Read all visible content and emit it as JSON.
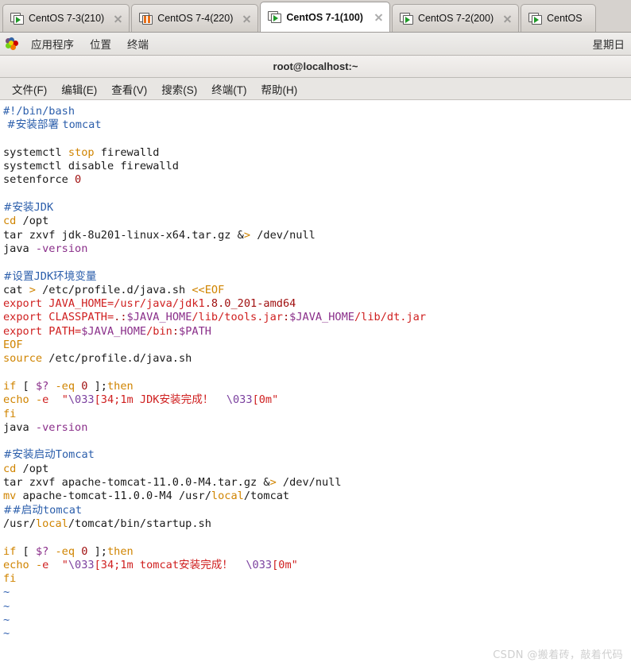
{
  "window": {
    "tabs": [
      {
        "label": "CentOS 7-3(210)",
        "state": "running",
        "active": false
      },
      {
        "label": "CentOS 7-4(220)",
        "state": "suspended",
        "active": false
      },
      {
        "label": "CentOS 7-1(100)",
        "state": "running",
        "active": true
      },
      {
        "label": "CentOS 7-2(200)",
        "state": "running",
        "active": false
      },
      {
        "label": "CentOS",
        "state": "running",
        "active": false
      }
    ]
  },
  "gnome_panel": {
    "applications": "应用程序",
    "places": "位置",
    "terminal": "终端",
    "clock": "星期日"
  },
  "terminal": {
    "title": "root@localhost:~",
    "menu": [
      "文件(F)",
      "编辑(E)",
      "查看(V)",
      "搜索(S)",
      "终端(T)",
      "帮助(H)"
    ]
  },
  "watermark": "CSDN @搬着砖，敲着代码",
  "colors": {
    "comment": "#2b5eab",
    "keyword": "#d08400",
    "string": "#cf1f1f",
    "number": "#a01010",
    "variable": "#8a2f8a",
    "special": "#7a3f9e",
    "normal": "#1a1a1a",
    "tab_active_bg": "#ffffff",
    "tabstrip_bg": "#d6d2ce",
    "terminal_bg": "#ffffff",
    "vm_running": "#1f9a28",
    "vm_suspended": "#e8701a"
  },
  "code": {
    "lines": [
      [
        [
          "#!/bin/bash",
          "cmt"
        ]
      ],
      [
        [
          " #安装部署 ",
          "cmt-cjk"
        ],
        [
          "tomcat",
          "cmt"
        ]
      ],
      [],
      [
        [
          "systemctl ",
          "id"
        ],
        [
          "stop",
          "kw"
        ],
        [
          " firewalld",
          "id"
        ]
      ],
      [
        [
          "systemctl disable firewalld",
          "id"
        ]
      ],
      [
        [
          "setenforce ",
          "id"
        ],
        [
          "0",
          "num"
        ]
      ],
      [],
      [
        [
          "#安装",
          "cmt-cjk"
        ],
        [
          "JDK",
          "cmt"
        ]
      ],
      [
        [
          "cd",
          "kw"
        ],
        [
          " /opt",
          "id"
        ]
      ],
      [
        [
          "tar zxvf jdk-8u201-linux-x64.tar.gz ",
          "id"
        ],
        [
          "&",
          "id"
        ],
        [
          ">",
          "op"
        ],
        [
          " /dev/null",
          "id"
        ]
      ],
      [
        [
          "java ",
          "id"
        ],
        [
          "-version",
          "var"
        ]
      ],
      [],
      [
        [
          "#设置",
          "cmt-cjk"
        ],
        [
          "JDK",
          "cmt"
        ],
        [
          "环境变量",
          "cmt-cjk"
        ]
      ],
      [
        [
          "cat ",
          "id"
        ],
        [
          ">",
          "op"
        ],
        [
          " /etc/profile.d/java.sh ",
          "id"
        ],
        [
          "<<EOF",
          "kw"
        ]
      ],
      [
        [
          "export ",
          "str"
        ],
        [
          "JAVA_HOME",
          "str"
        ],
        [
          "=",
          "str"
        ],
        [
          "/usr/java/jdk1",
          "str"
        ],
        [
          ".8.0_201-amd64",
          "num"
        ]
      ],
      [
        [
          "export ",
          "str"
        ],
        [
          "CLASSPATH",
          "str"
        ],
        [
          "=",
          ".str"
        ],
        [
          ".:",
          "num"
        ],
        [
          "$JAVA_HOME",
          "var"
        ],
        [
          "/lib/tools.jar",
          "str"
        ],
        [
          ":",
          "num"
        ],
        [
          "$JAVA_HOME",
          "var"
        ],
        [
          "/lib/dt.jar",
          "str"
        ]
      ],
      [
        [
          "export ",
          "str"
        ],
        [
          "PATH",
          "str"
        ],
        [
          "=",
          "str"
        ],
        [
          "$JAVA_HOME",
          "var"
        ],
        [
          "/bin",
          "str"
        ],
        [
          ":",
          "num"
        ],
        [
          "$PATH",
          "var"
        ]
      ],
      [
        [
          "EOF",
          "kw"
        ]
      ],
      [
        [
          "source",
          "kw"
        ],
        [
          " /etc/profile.d/java.sh",
          "id"
        ]
      ],
      [],
      [
        [
          "if",
          "kw"
        ],
        [
          " [ ",
          "id"
        ],
        [
          "$?",
          "var"
        ],
        [
          " ",
          "id"
        ],
        [
          "-eq",
          "kw"
        ],
        [
          " ",
          "id"
        ],
        [
          "0",
          "num"
        ],
        [
          " ];",
          "id"
        ],
        [
          "then",
          "kw"
        ]
      ],
      [
        [
          "echo",
          "kw"
        ],
        [
          " ",
          "id"
        ],
        [
          "-",
          "kw"
        ],
        [
          "e",
          "str"
        ],
        [
          "  ",
          "id"
        ],
        [
          "\"",
          "str"
        ],
        [
          "\\033",
          "spec"
        ],
        [
          "[34;1m JDK",
          "str"
        ],
        [
          "安装完成！",
          "str-cjk"
        ],
        [
          "  ",
          "str"
        ],
        [
          "\\033",
          "spec"
        ],
        [
          "[0m\"",
          "str"
        ]
      ],
      [
        [
          "fi",
          "kw"
        ]
      ],
      [
        [
          "java ",
          "id"
        ],
        [
          "-version",
          "var"
        ]
      ],
      [],
      [
        [
          "#安装启动",
          "cmt-cjk"
        ],
        [
          "Tomcat",
          "cmt"
        ]
      ],
      [
        [
          "cd",
          "kw"
        ],
        [
          " /opt",
          "id"
        ]
      ],
      [
        [
          "tar zxvf apache-tomcat-11.0.0-M4.tar.gz ",
          "id"
        ],
        [
          "&",
          "id"
        ],
        [
          ">",
          "op"
        ],
        [
          " /dev/null",
          "id"
        ]
      ],
      [
        [
          "mv",
          "kw"
        ],
        [
          " apache-tomcat-11.0.0-M4 /usr/",
          "id"
        ],
        [
          "local",
          "kw"
        ],
        [
          "/tomcat",
          "id"
        ]
      ],
      [
        [
          "##启动",
          "cmt-cjk"
        ],
        [
          "tomcat",
          "cmt"
        ]
      ],
      [
        [
          "/usr/",
          "id"
        ],
        [
          "local",
          "kw"
        ],
        [
          "/tomcat/bin/startup.sh",
          "id"
        ]
      ],
      [],
      [
        [
          "if",
          "kw"
        ],
        [
          " [ ",
          "id"
        ],
        [
          "$?",
          "var"
        ],
        [
          " ",
          "id"
        ],
        [
          "-eq",
          "kw"
        ],
        [
          " ",
          "id"
        ],
        [
          "0",
          "num"
        ],
        [
          " ];",
          "id"
        ],
        [
          "then",
          "kw"
        ]
      ],
      [
        [
          "echo",
          "kw"
        ],
        [
          " ",
          "id"
        ],
        [
          "-",
          "kw"
        ],
        [
          "e",
          "str"
        ],
        [
          "  ",
          "id"
        ],
        [
          "\"",
          "str"
        ],
        [
          "\\033",
          "spec"
        ],
        [
          "[34;1m tomcat",
          "str"
        ],
        [
          "安装完成！",
          "str-cjk"
        ],
        [
          "  ",
          "str"
        ],
        [
          "\\033",
          "spec"
        ],
        [
          "[0m\"",
          "str"
        ]
      ],
      [
        [
          "fi",
          "kw"
        ]
      ],
      [
        [
          "~",
          "til"
        ]
      ],
      [
        [
          "~",
          "til"
        ]
      ],
      [
        [
          "~",
          "til"
        ]
      ],
      [
        [
          "~",
          "til"
        ]
      ]
    ]
  }
}
